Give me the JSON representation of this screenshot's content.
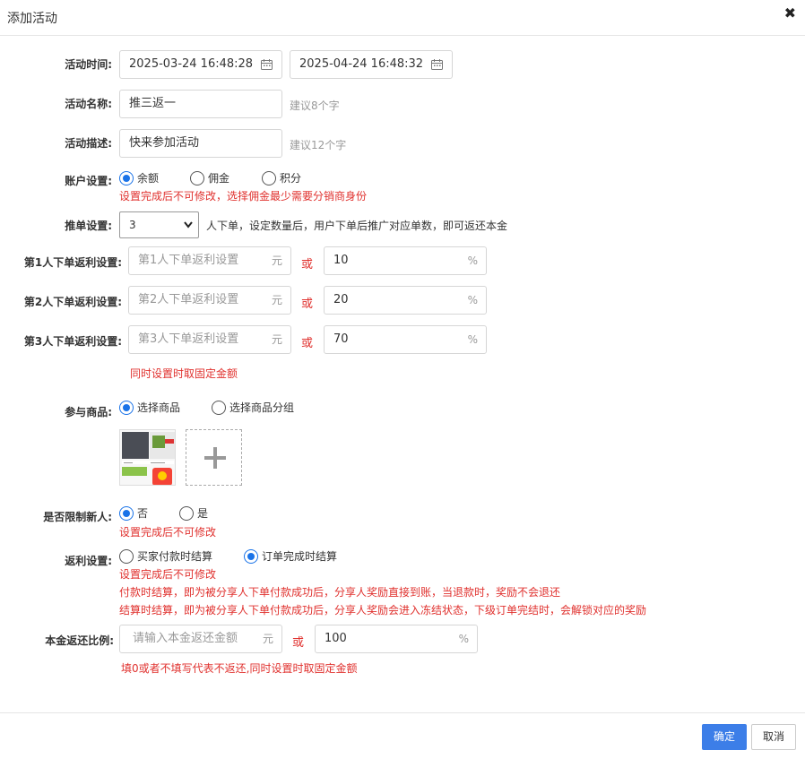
{
  "dialog": {
    "title": "添加活动",
    "close_icon": "close-icon"
  },
  "activity_time": {
    "label": "活动时间:",
    "start": "2025-03-24 16:48:28",
    "end": "2025-04-24 16:48:32"
  },
  "activity_name": {
    "label": "活动名称:",
    "value": "推三返一",
    "hint": "建议8个字"
  },
  "activity_desc": {
    "label": "活动描述:",
    "value": "快来参加活动",
    "hint": "建议12个字"
  },
  "account": {
    "label": "账户设置:",
    "options": [
      "余额",
      "佣金",
      "积分"
    ],
    "selected": "余额",
    "note": "设置完成后不可修改，选择佣金最少需要分销商身份"
  },
  "push_orders": {
    "label": "推单设置:",
    "value": "3",
    "after": "人下单，设定数量后，用户下单后推广对应单数，即可返还本金"
  },
  "rebates": [
    {
      "label": "第1人下单返利设置:",
      "placeholder": "第1人下单返利设置",
      "unit": "元",
      "or": "或",
      "percent": "10",
      "pct_unit": "%"
    },
    {
      "label": "第2人下单返利设置:",
      "placeholder": "第2人下单返利设置",
      "unit": "元",
      "or": "或",
      "percent": "20",
      "pct_unit": "%"
    },
    {
      "label": "第3人下单返利设置:",
      "placeholder": "第3人下单返利设置",
      "unit": "元",
      "or": "或",
      "percent": "70",
      "pct_unit": "%"
    }
  ],
  "rebate_note": "同时设置时取固定金额",
  "goods": {
    "label": "参与商品:",
    "options": [
      "选择商品",
      "选择商品分组"
    ],
    "selected": "选择商品"
  },
  "new_user": {
    "label": "是否限制新人:",
    "options": [
      "否",
      "是"
    ],
    "selected": "否",
    "note": "设置完成后不可修改"
  },
  "settlement": {
    "label": "返利设置:",
    "options": [
      "买家付款时结算",
      "订单完成时结算"
    ],
    "selected": "订单完成时结算",
    "note1": "设置完成后不可修改",
    "note2": "付款时结算，即为被分享人下单付款成功后，分享人奖励直接到账，当退款时，奖励不会退还",
    "note3": "结算时结算，即为被分享人下单付款成功后，分享人奖励会进入冻结状态，下级订单完结时，会解锁对应的奖励"
  },
  "principal": {
    "label": "本金返还比例:",
    "placeholder": "请输入本金返还金额",
    "unit": "元",
    "or": "或",
    "percent": "100",
    "pct_unit": "%",
    "note": "填0或者不填写代表不返还,同时设置时取固定金额"
  },
  "buttons": {
    "confirm": "确定",
    "cancel": "取消"
  },
  "colors": {
    "accent": "#1a73e8",
    "primary_button": "#3c7ee8",
    "warning": "#e0312e"
  }
}
